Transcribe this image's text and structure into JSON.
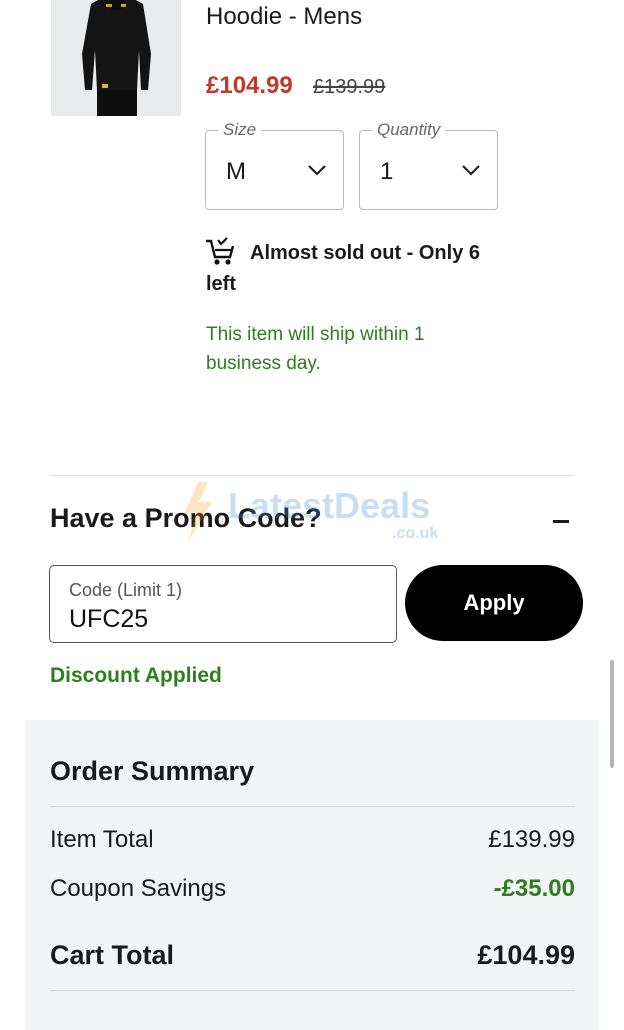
{
  "product": {
    "title": "Hoodie - Mens",
    "price_now": "£104.99",
    "price_was": "£139.99",
    "image_icon": "product-photo-hoodie"
  },
  "size": {
    "legend": "Size",
    "value": "M"
  },
  "quantity": {
    "legend": "Quantity",
    "value": "1"
  },
  "stock": {
    "icon": "cart-icon",
    "text": "Almost sold out - Only 6 left"
  },
  "shipping": {
    "text": "This item will ship within 1 business day."
  },
  "promo": {
    "title": "Have a Promo Code?",
    "toggle_icon": "minus-icon",
    "field_label": "Code (Limit 1)",
    "field_value": "UFC25",
    "apply_label": "Apply",
    "status": "Discount Applied"
  },
  "watermark": {
    "brand": "LatestDeals",
    "domain": ".co.uk"
  },
  "summary": {
    "title": "Order Summary",
    "rows": [
      {
        "label": "Item Total",
        "value": "£139.99"
      },
      {
        "label": "Coupon Savings",
        "value": "-£35.00"
      }
    ],
    "cart_total_label": "Cart Total",
    "cart_total_value": "£104.99"
  },
  "colors": {
    "sale_price": "#c0392b",
    "success": "#2e7d1f",
    "button_bg": "#000000",
    "summary_bg": "#f2f4f6"
  }
}
